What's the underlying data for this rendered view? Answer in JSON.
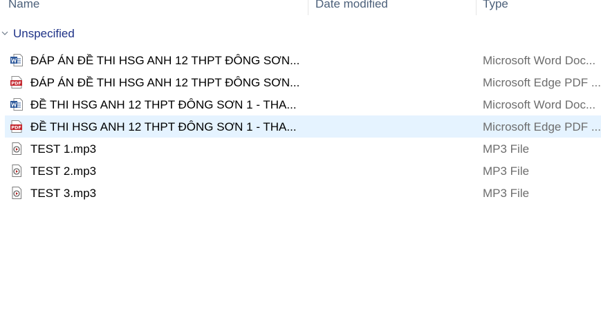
{
  "columns": {
    "name": "Name",
    "date_modified": "Date modified",
    "type": "Type"
  },
  "group": {
    "title": "Unspecified"
  },
  "files": [
    {
      "name": "ĐÁP ÁN ĐỀ THI HSG ANH 12 THPT ĐÔNG SƠN...",
      "type": "Microsoft Word Doc...",
      "icon": "word-doc-icon",
      "selected": false
    },
    {
      "name": "ĐÁP ÁN ĐỀ THI HSG ANH 12 THPT ĐÔNG SƠN...",
      "type": "Microsoft Edge PDF ...",
      "icon": "pdf-icon",
      "selected": false
    },
    {
      "name": "ĐỀ THI HSG ANH 12 THPT ĐÔNG SƠN 1 - THA...",
      "type": "Microsoft Word Doc...",
      "icon": "word-doc-icon",
      "selected": false
    },
    {
      "name": "ĐỀ THI HSG ANH 12 THPT ĐÔNG SƠN 1 - THA...",
      "type": "Microsoft Edge PDF ...",
      "icon": "pdf-icon",
      "selected": true
    },
    {
      "name": "TEST 1.mp3",
      "type": "MP3 File",
      "icon": "audio-file-icon",
      "selected": false
    },
    {
      "name": "TEST 2.mp3",
      "type": "MP3 File",
      "icon": "audio-file-icon",
      "selected": false
    },
    {
      "name": "TEST 3.mp3",
      "type": "MP3 File",
      "icon": "audio-file-icon",
      "selected": false
    }
  ],
  "colors": {
    "selection": "#e5f3ff",
    "group_title": "#1e3287",
    "header_text": "#4c607a",
    "type_text": "#6d6d6d",
    "word_blue": "#2b579a",
    "pdf_red": "#c4262e"
  }
}
